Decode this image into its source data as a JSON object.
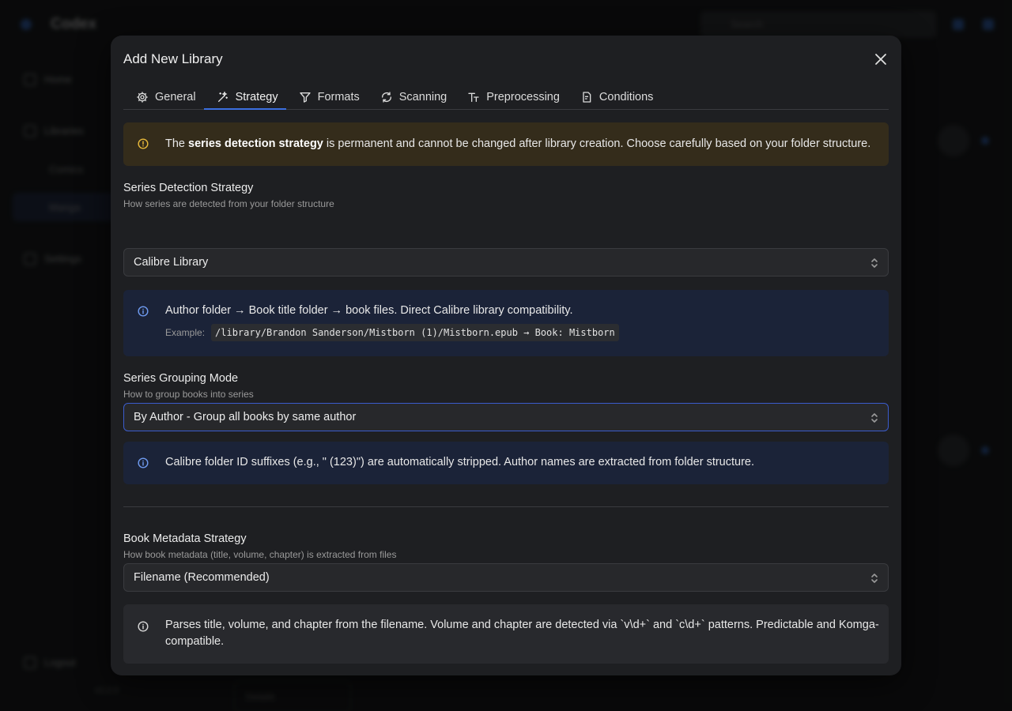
{
  "background": {
    "app_name": "Codex",
    "search_placeholder": "Search",
    "nav": [
      "Home",
      "Libraries",
      "Settings",
      "Logout"
    ],
    "sub_items": [
      "Comics",
      "Manga"
    ],
    "version": "v1.0.0",
    "footer_label": "Details"
  },
  "modal": {
    "title": "Add New Library",
    "tabs": [
      {
        "label": "General",
        "icon": "gear-icon"
      },
      {
        "label": "Strategy",
        "icon": "wand-icon",
        "active": true
      },
      {
        "label": "Formats",
        "icon": "filter-icon"
      },
      {
        "label": "Scanning",
        "icon": "refresh-icon"
      },
      {
        "label": "Preprocessing",
        "icon": "text-size-icon"
      },
      {
        "label": "Conditions",
        "icon": "file-check-icon"
      }
    ],
    "warning": {
      "prefix": "The ",
      "bold": "series detection strategy",
      "suffix": " is permanent and cannot be changed after library creation. Choose carefully based on your folder structure."
    },
    "series_detection": {
      "label": "Series Detection Strategy",
      "help": "How series are detected from your folder structure",
      "value": "Calibre Library",
      "info": "Author folder → Book title folder → book files. Direct Calibre library compatibility.",
      "example_label": "Example:",
      "example_code": "/library/Brandon Sanderson/Mistborn (1)/Mistborn.epub → Book: Mistborn"
    },
    "series_grouping": {
      "label": "Series Grouping Mode",
      "help": "How to group books into series",
      "value": "By Author - Group all books by same author",
      "info": "Calibre folder ID suffixes (e.g., \" (123)\") are automatically stripped. Author names are extracted from folder structure."
    },
    "book_metadata": {
      "label": "Book Metadata Strategy",
      "help": "How book metadata (title, volume, chapter) is extracted from files",
      "value": "Filename (Recommended)",
      "info_line1": "Parses title, volume, and chapter from the filename. Volume and chapter are detected via `v\\d+` and `c\\d+` patterns. Predictable and Komga-",
      "info_line2": "compatible."
    }
  },
  "colors": {
    "accent": "#3b6fe0",
    "warning_bg": "#342c1b",
    "warning_icon": "#e8b93a",
    "info_bg": "#1b2338",
    "info_icon": "#6f9bf0",
    "modal_bg": "#1e1f22"
  }
}
